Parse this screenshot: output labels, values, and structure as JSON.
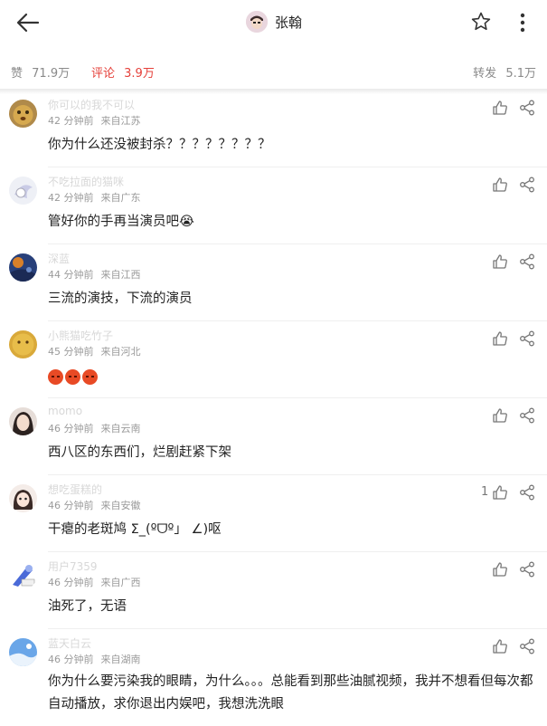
{
  "header": {
    "title": "张翰",
    "back_icon": "back-arrow-icon",
    "star_icon": "star-icon",
    "more_icon": "more-vertical-icon"
  },
  "stats": {
    "likes_label": "赞",
    "likes_count": "71.9万",
    "comments_label": "评论",
    "comments_count": "3.9万",
    "reposts_label": "转发",
    "reposts_count": "5.1万",
    "active_color": "#e5403a"
  },
  "comments": [
    {
      "username": "你可以的我不可以",
      "time": "42 分钟前",
      "location": "来自江苏",
      "text": "你为什么还没被封杀？？？？？？？？",
      "like_count": ""
    },
    {
      "username": "不吃拉面的猫咪",
      "time": "42 分钟前",
      "location": "来自广东",
      "text": "管好你的手再当演员吧😭",
      "like_count": ""
    },
    {
      "username": "深蓝",
      "time": "44 分钟前",
      "location": "来自江西",
      "text": "三流的演技，下流的演员",
      "like_count": ""
    },
    {
      "username": "小熊猫吃竹子",
      "time": "45 分钟前",
      "location": "来自河北",
      "text": "",
      "like_count": ""
    },
    {
      "username": "momo",
      "time": "46 分钟前",
      "location": "来自云南",
      "text": "西八区的东西们，烂剧赶紧下架",
      "like_count": ""
    },
    {
      "username": "想吃蛋糕的",
      "time": "46 分钟前",
      "location": "来自安徽",
      "text": "干瘪的老斑鸠 Σ_(ºᗜº」 ∠)呕",
      "like_count": "1"
    },
    {
      "username": "用户7359",
      "time": "46 分钟前",
      "location": "来自广西",
      "text": "油死了，无语",
      "like_count": ""
    },
    {
      "username": "蓝天白云",
      "time": "46 分钟前",
      "location": "来自湖南",
      "text": "你为什么要污染我的眼睛，为什么。。。总能看到那些油腻视频，我并不想看但每次都自动播放，求你退出内娱吧，我想洗洗眼",
      "like_count": ""
    }
  ],
  "icons": {
    "like": "thumbs-up-icon",
    "share": "share-icon"
  }
}
